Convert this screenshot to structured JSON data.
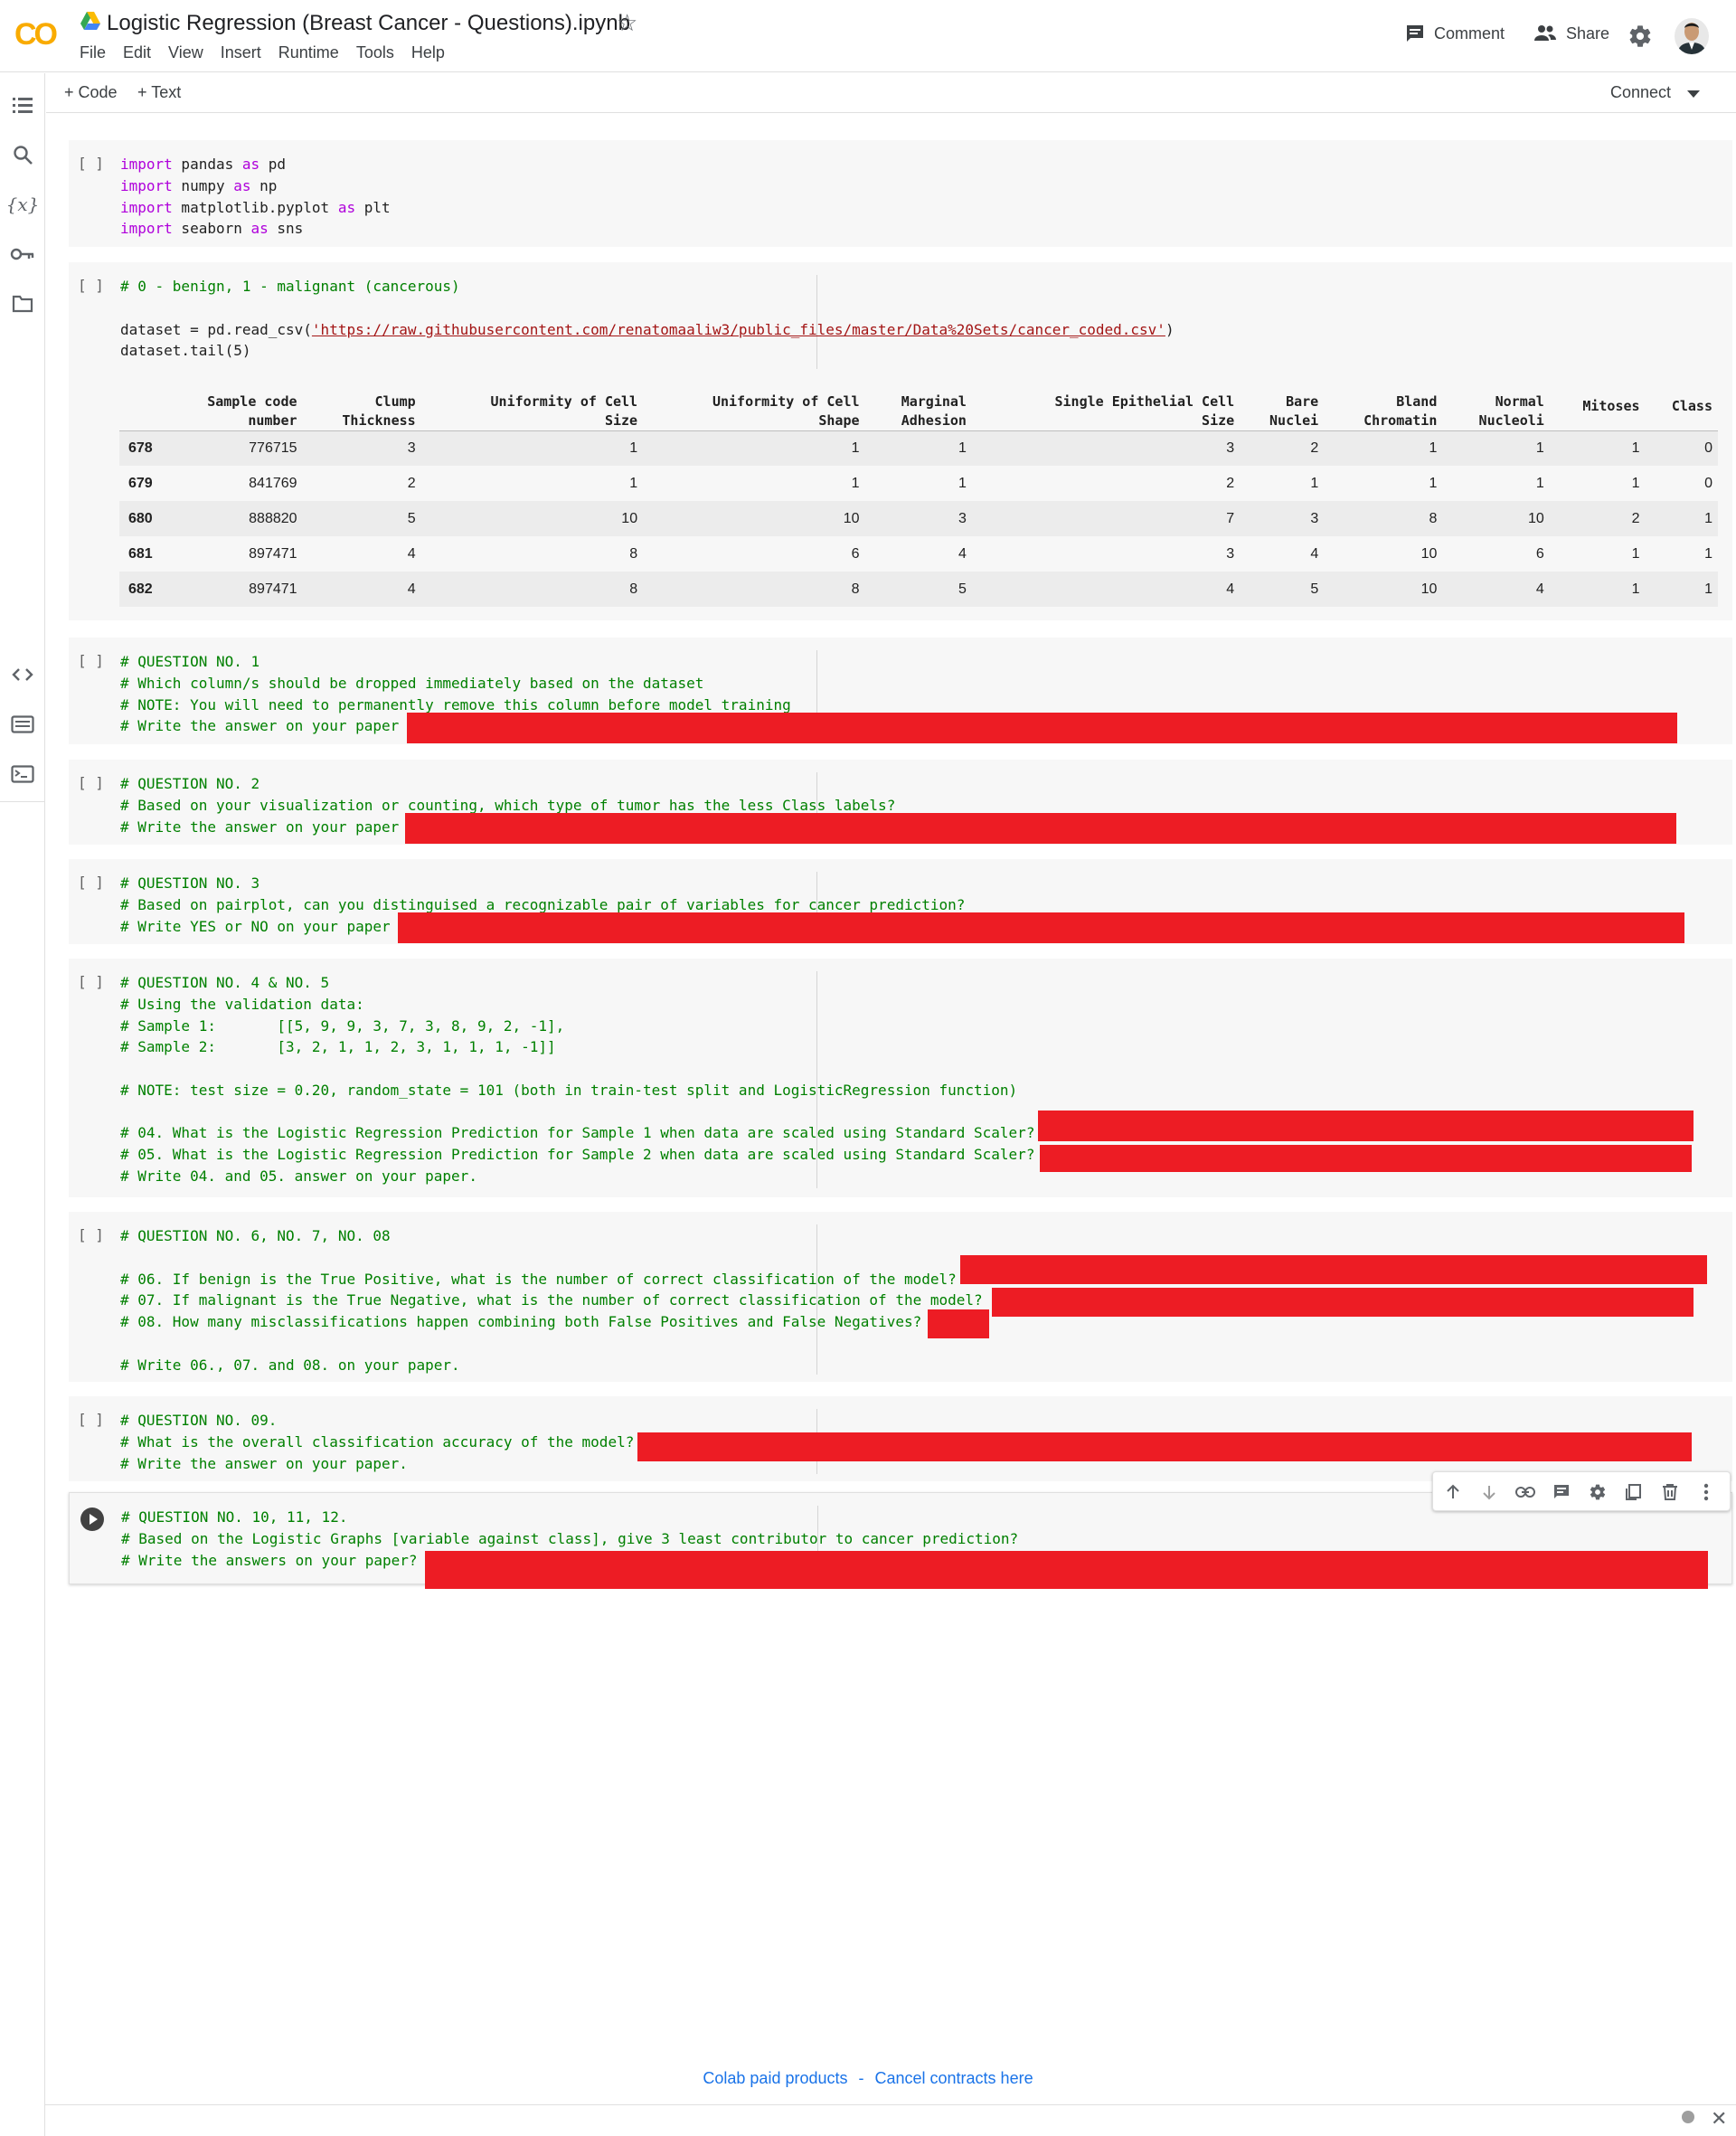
{
  "header": {
    "title": "Logistic Regression (Breast Cancer - Questions).ipynb",
    "menu": [
      "File",
      "Edit",
      "View",
      "Insert",
      "Runtime",
      "Tools",
      "Help"
    ],
    "comment_label": "Comment",
    "share_label": "Share",
    "logo_text": "CO"
  },
  "toolbar": {
    "add_code_label": "+ Code",
    "add_text_label": "+ Text",
    "connect_label": "Connect"
  },
  "icons": {
    "rail": [
      "table-of-contents-icon",
      "search-icon",
      "variables-icon",
      "secrets-key-icon",
      "files-folder-icon",
      "code-snippets-icon",
      "command-palette-icon",
      "terminal-icon"
    ],
    "cell_toolbar": [
      "move-up-icon",
      "move-down-icon",
      "link-icon",
      "comment-icon",
      "settings-icon",
      "mirror-cell-icon",
      "delete-icon",
      "more-options-icon"
    ]
  },
  "cells": {
    "bracket": "[ ]",
    "imports": [
      {
        "kw": "import",
        "mod": " pandas ",
        "as": "as",
        "alias": " pd"
      },
      {
        "kw": "import",
        "mod": " numpy ",
        "as": "as",
        "alias": " np"
      },
      {
        "kw": "import",
        "mod": " matplotlib.pyplot ",
        "as": "as",
        "alias": " plt"
      },
      {
        "kw": "import",
        "mod": " seaborn ",
        "as": "as",
        "alias": " sns"
      }
    ],
    "dataset": {
      "comment": "# 0 - benign, 1 - malignant (cancerous)",
      "read_prefix": "dataset = pd.read_csv(",
      "url": "'https://raw.githubusercontent.com/renatomaaliw3/public_files/master/Data%20Sets/cancer_coded.csv'",
      "read_suffix": ")",
      "tail_line": "dataset.tail(5)"
    },
    "q1": [
      "# QUESTION NO. 1",
      "# Which column/s should be dropped immediately based on the dataset",
      "# NOTE: You will need to permanently remove this column before model training",
      "# Write the answer on your paper"
    ],
    "q2": [
      "# QUESTION NO. 2",
      "# Based on your visualization or counting, which type of tumor has the less Class labels?",
      "# Write the answer on your paper"
    ],
    "q3": [
      "# QUESTION NO. 3",
      "# Based on pairplot, can you distinguised a recognizable pair of variables for cancer prediction?",
      "# Write YES or NO on your paper"
    ],
    "q4": [
      "# QUESTION NO. 4 & NO. 5",
      "# Using the validation data:",
      "# Sample 1:       [[5, 9, 9, 3, 7, 3, 8, 9, 2, -1],",
      "# Sample 2:       [3, 2, 1, 1, 2, 3, 1, 1, 1, -1]]",
      "",
      "# NOTE: test size = 0.20, random_state = 101 (both in train-test split and LogisticRegression function)",
      "",
      "# 04. What is the Logistic Regression Prediction for Sample 1 when data are scaled using Standard Scaler?",
      "# 05. What is the Logistic Regression Prediction for Sample 2 when data are scaled using Standard Scaler?",
      "# Write 04. and 05. answer on your paper."
    ],
    "q6": [
      "# QUESTION NO. 6, NO. 7, NO. 08",
      "",
      "# 06. If benign is the True Positive, what is the number of correct classification of the model?",
      "# 07. If malignant is the True Negative, what is the number of correct classification of the model?",
      "# 08. How many misclassifications happen combining both False Positives and False Negatives?",
      "",
      "# Write 06., 07. and 08. on your paper."
    ],
    "q9": [
      "# QUESTION NO. 09.",
      "# What is the overall classification accuracy of the model?",
      "# Write the answer on your paper."
    ],
    "q10": [
      "# QUESTION NO. 10, 11, 12.",
      "# Based on the Logistic Graphs [variable against class], give 3 least contributor to cancer prediction?",
      "# Write the answers on your paper?"
    ]
  },
  "table": {
    "headers": [
      [
        "Sample code",
        "number"
      ],
      [
        "Clump",
        "Thickness"
      ],
      [
        "Uniformity of Cell",
        "Size"
      ],
      [
        "Uniformity of Cell",
        "Shape"
      ],
      [
        "Marginal",
        "Adhesion"
      ],
      [
        "Single Epithelial Cell",
        "Size"
      ],
      [
        "Bare",
        "Nuclei"
      ],
      [
        "Bland",
        "Chromatin"
      ],
      [
        "Normal",
        "Nucleoli"
      ],
      [
        "",
        "Mitoses"
      ],
      [
        "",
        "Class"
      ]
    ],
    "rows": [
      {
        "index": "678",
        "cells": [
          "776715",
          "3",
          "1",
          "1",
          "1",
          "3",
          "2",
          "1",
          "1",
          "1",
          "0"
        ]
      },
      {
        "index": "679",
        "cells": [
          "841769",
          "2",
          "1",
          "1",
          "1",
          "2",
          "1",
          "1",
          "1",
          "1",
          "0"
        ]
      },
      {
        "index": "680",
        "cells": [
          "888820",
          "5",
          "10",
          "10",
          "3",
          "7",
          "3",
          "8",
          "10",
          "2",
          "1"
        ]
      },
      {
        "index": "681",
        "cells": [
          "897471",
          "4",
          "8",
          "6",
          "4",
          "3",
          "4",
          "10",
          "6",
          "1",
          "1"
        ]
      },
      {
        "index": "682",
        "cells": [
          "897471",
          "4",
          "8",
          "8",
          "5",
          "4",
          "5",
          "10",
          "4",
          "1",
          "1"
        ]
      }
    ]
  },
  "footer": {
    "paid_products": "Colab paid products",
    "separator": "-",
    "cancel_contracts": "Cancel contracts here"
  },
  "colors": {
    "redaction": "#ed1c24",
    "keyword": "#af00db",
    "comment": "#008000",
    "link": "#1a73e8"
  }
}
